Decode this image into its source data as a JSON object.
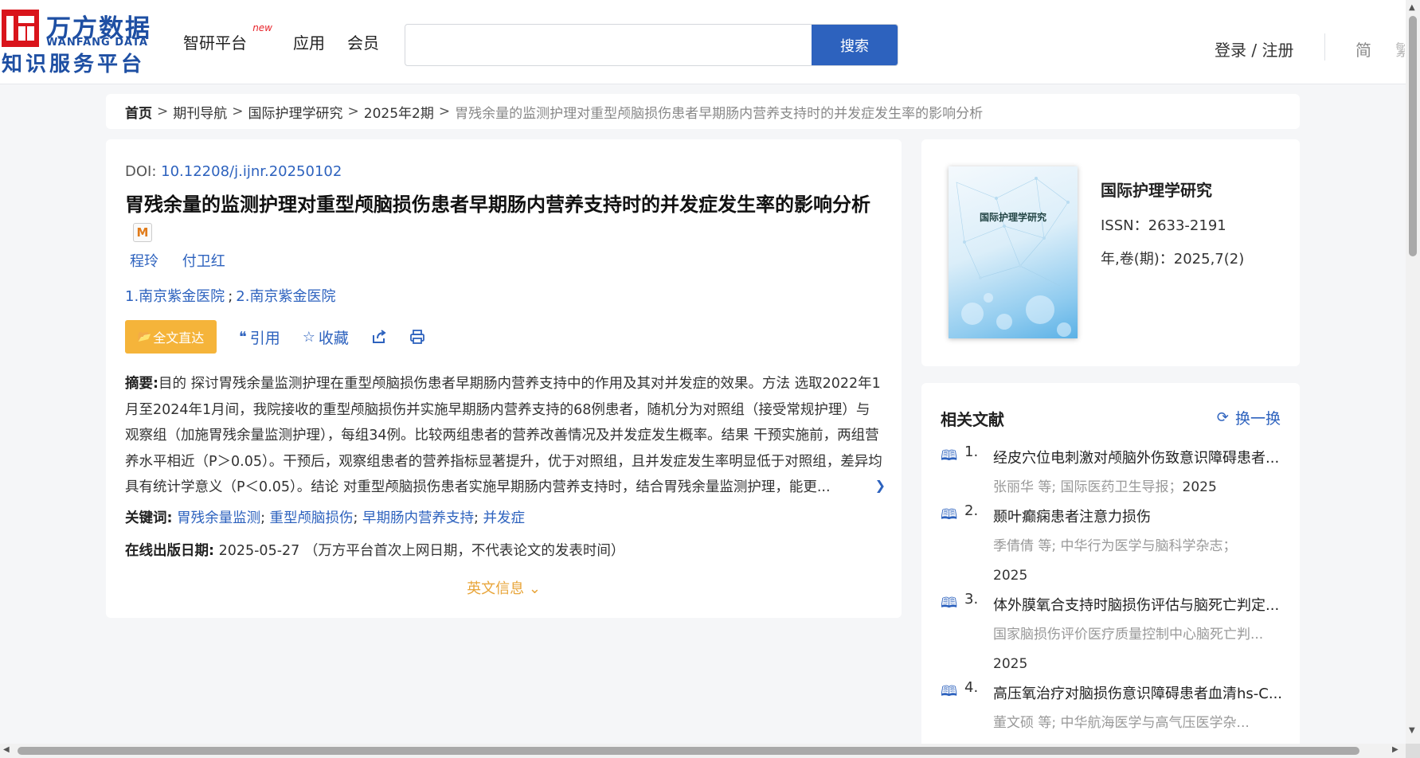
{
  "header": {
    "logo_cn": "万方数据",
    "logo_en": "WANFANG DATA",
    "logo_sub": "知识服务平台",
    "nav": [
      {
        "label": "智研平台",
        "badge": "new"
      },
      {
        "label": "应用"
      },
      {
        "label": "会员"
      }
    ],
    "search_placeholder": "",
    "search_button": "搜索",
    "login": "登录 / 注册",
    "lang_simplified": "简",
    "lang_traditional": "繁"
  },
  "breadcrumb": {
    "home": "首页",
    "items": [
      "期刊导航",
      "国际护理学研究",
      "2025年2期"
    ],
    "current": "胃残余量的监测护理对重型颅脑损伤患者早期肠内营养支持时的并发症发生率的影响分析",
    "separator": ">"
  },
  "article": {
    "doi_label": "DOI:",
    "doi_value": "10.12208/j.ijnr.20250102",
    "title": "胃残余量的监测护理对重型颅脑损伤患者早期肠内营养支持时的并发症发生率的影响分析",
    "badge": "M",
    "authors": [
      "程玲",
      "付卫红"
    ],
    "affiliations": [
      "1.南京紫金医院",
      "2.南京紫金医院"
    ],
    "actions": {
      "fulltext": "全文直达",
      "cite": "引用",
      "favorite": "收藏"
    },
    "abstract_label": "摘要:",
    "abstract": "目的 探讨胃残余量监测护理在重型颅脑损伤患者早期肠内营养支持中的作用及其对并发症的效果。方法 选取2022年1月至2024年1月间，我院接收的重型颅脑损伤并实施早期肠内营养支持的68例患者，随机分为对照组（接受常规护理）与观察组（加施胃残余量监测护理），每组34例。比较两组患者的营养改善情况及并发症发生概率。结果 干预实施前，两组营养水平相近（P＞0.05）。干预后，观察组患者的营养指标显著提升，优于对照组，且并发症发生率明显低于对照组，差异均具有统计学意义（P＜0.05）。结论 对重型颅脑损伤患者实施早期肠内营养支持时，结合胃残余量监测护理，能更...",
    "keywords_label": "关键词:",
    "keywords": [
      "胃残余量监测",
      "重型颅脑损伤",
      "早期肠内营养支持",
      "并发症"
    ],
    "pubdate_label": "在线出版日期:",
    "pubdate": "2025-05-27",
    "pubdate_note": "（万方平台首次上网日期，不代表论文的发表时间）",
    "english_info": "英文信息"
  },
  "journal": {
    "cover_title": "国际护理学研究",
    "name": "国际护理学研究",
    "issn": "ISSN：2633-2191",
    "volume": "年,卷(期)：2025,7(2)"
  },
  "related": {
    "heading": "相关文献",
    "refresh": "换一换",
    "items": [
      {
        "num": "1.",
        "title": "经皮穴位电刺激对颅脑外伤致意识障碍患者...",
        "meta": "张丽华  等;  国际医药卫生导报；",
        "year": "2025"
      },
      {
        "num": "2.",
        "title": "颞叶癫痫患者注意力损伤",
        "meta": "季倩倩  等;  中华行为医学与脑科学杂志；",
        "year": "2025"
      },
      {
        "num": "3.",
        "title": "体外膜氧合支持时脑损伤评估与脑死亡判定...",
        "meta": "国家脑损伤评价医疗质量控制中心脑死亡判...",
        "year": "2025"
      },
      {
        "num": "4.",
        "title": "高压氧治疗对脑损伤意识障碍患者血清hs-C...",
        "meta": "董文硕  等;  中华航海医学与高气压医学杂...",
        "year": ""
      }
    ]
  }
}
